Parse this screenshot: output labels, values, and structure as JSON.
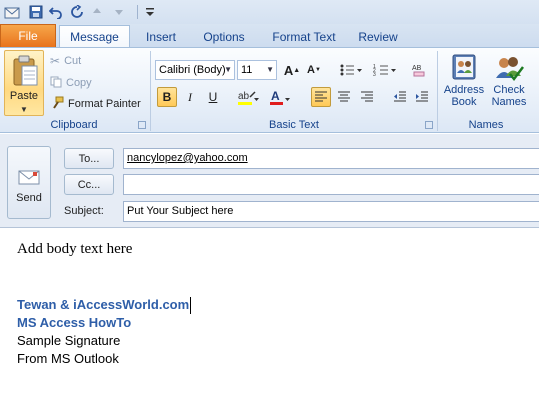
{
  "ribbon": {
    "tabs": [
      "File",
      "Message",
      "Insert",
      "Options",
      "Format Text",
      "Review"
    ],
    "active_tab": "Message",
    "clipboard": {
      "paste_label": "Paste",
      "cut_label": "Cut",
      "copy_label": "Copy",
      "format_painter_label": "Format Painter",
      "group_label": "Clipboard"
    },
    "basic_text": {
      "font_name": "Calibri (Body)",
      "font_size": "11",
      "bold_label": "B",
      "italic_label": "I",
      "underline_label": "U",
      "group_label": "Basic Text",
      "highlight_color": "#ffff00",
      "font_color": "#e01d1d"
    },
    "names": {
      "address_book_label_1": "Address",
      "address_book_label_2": "Book",
      "check_names_label_1": "Check",
      "check_names_label_2": "Names",
      "group_label": "Names"
    }
  },
  "compose": {
    "send_label": "Send",
    "to_button": "To...",
    "cc_button": "Cc...",
    "subject_label": "Subject:",
    "to_value": "nancylopez@yahoo.com",
    "cc_value": "",
    "subject_value": "Put Your Subject here"
  },
  "body": {
    "text": "Add body text here",
    "signature": [
      "Tewan & iAccessWorld.com",
      "MS Access HowTo",
      "Sample Signature",
      "From MS Outlook"
    ]
  },
  "colors": {
    "accent": "#2e5ea8",
    "file_tab": "#e8731c"
  }
}
